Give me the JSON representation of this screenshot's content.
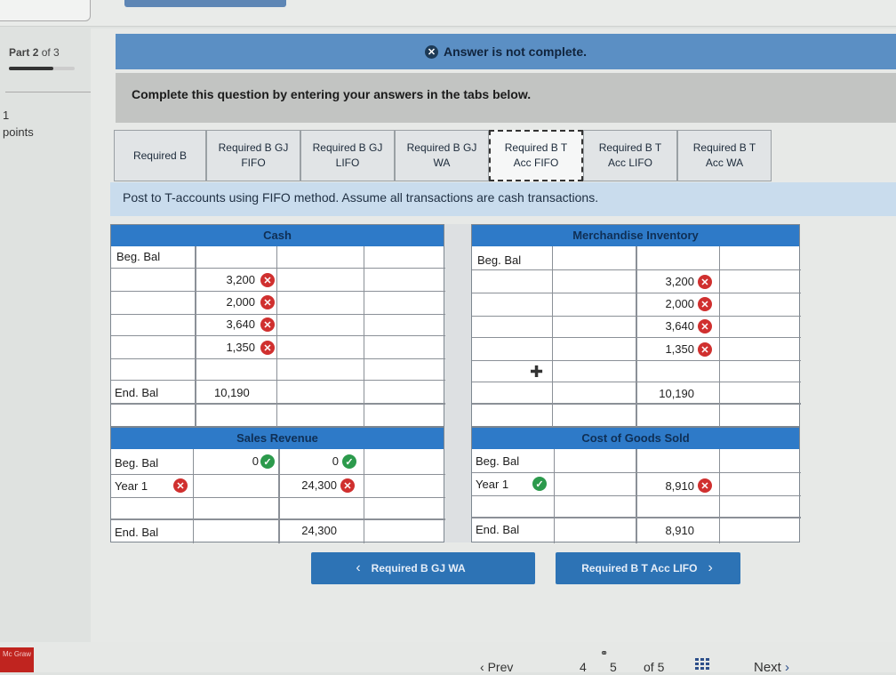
{
  "progress": {
    "part_label": "Part",
    "part_current": "2",
    "part_of": "of 3",
    "fraction": 0.67
  },
  "points": {
    "value": "1",
    "label": "points"
  },
  "banner": {
    "text": "Answer is not complete.",
    "icon": "x-circle-icon"
  },
  "instruction": "Complete this question by entering your answers in the tabs below.",
  "tabs": [
    {
      "label": "Required B",
      "active": false
    },
    {
      "label": "Required B GJ\nFIFO",
      "active": false
    },
    {
      "label": "Required B GJ\nLIFO",
      "active": false
    },
    {
      "label": "Required B GJ\nWA",
      "active": false
    },
    {
      "label": "Required B T\nAcc FIFO",
      "active": true
    },
    {
      "label": "Required B T\nAcc LIFO",
      "active": false
    },
    {
      "label": "Required B T\nAcc WA",
      "active": false
    }
  ],
  "sub_instruction": "Post to T-accounts using FIFO method. Assume all transactions are cash transactions.",
  "cash": {
    "title": "Cash",
    "beg_label": "Beg. Bal",
    "debits": [
      "3,200",
      "2,000",
      "3,640",
      "1,350"
    ],
    "end_label": "End. Bal",
    "end_value": "10,190"
  },
  "merch": {
    "title": "Merchandise Inventory",
    "beg_label": "Beg. Bal",
    "credits": [
      "3,200",
      "2,000",
      "3,640",
      "1,350"
    ],
    "end_value": "10,190"
  },
  "sales": {
    "title": "Sales Revenue",
    "beg_label": "Beg. Bal",
    "beg_debit": "0",
    "beg_credit": "0",
    "year_label": "Year 1",
    "year_credit": "24,300",
    "end_label": "End. Bal",
    "end_value": "24,300"
  },
  "cogs": {
    "title": "Cost of Goods Sold",
    "beg_label": "Beg. Bal",
    "year_label": "Year 1",
    "year_value": "8,910",
    "end_label": "End. Bal",
    "end_value": "8,910"
  },
  "nav": {
    "prev_tab": "Required B GJ WA",
    "next_tab": "Required B T Acc LIFO"
  },
  "bottom": {
    "logo": "Mc Graw",
    "prev": "Prev",
    "page_a": "4",
    "page_b": "5",
    "of": "of 5",
    "next": "Next"
  },
  "colors": {
    "wrong": "#d0302f",
    "correct": "#2c9a4c",
    "header": "#2e7ac8",
    "banner": "#5b8fc4"
  }
}
